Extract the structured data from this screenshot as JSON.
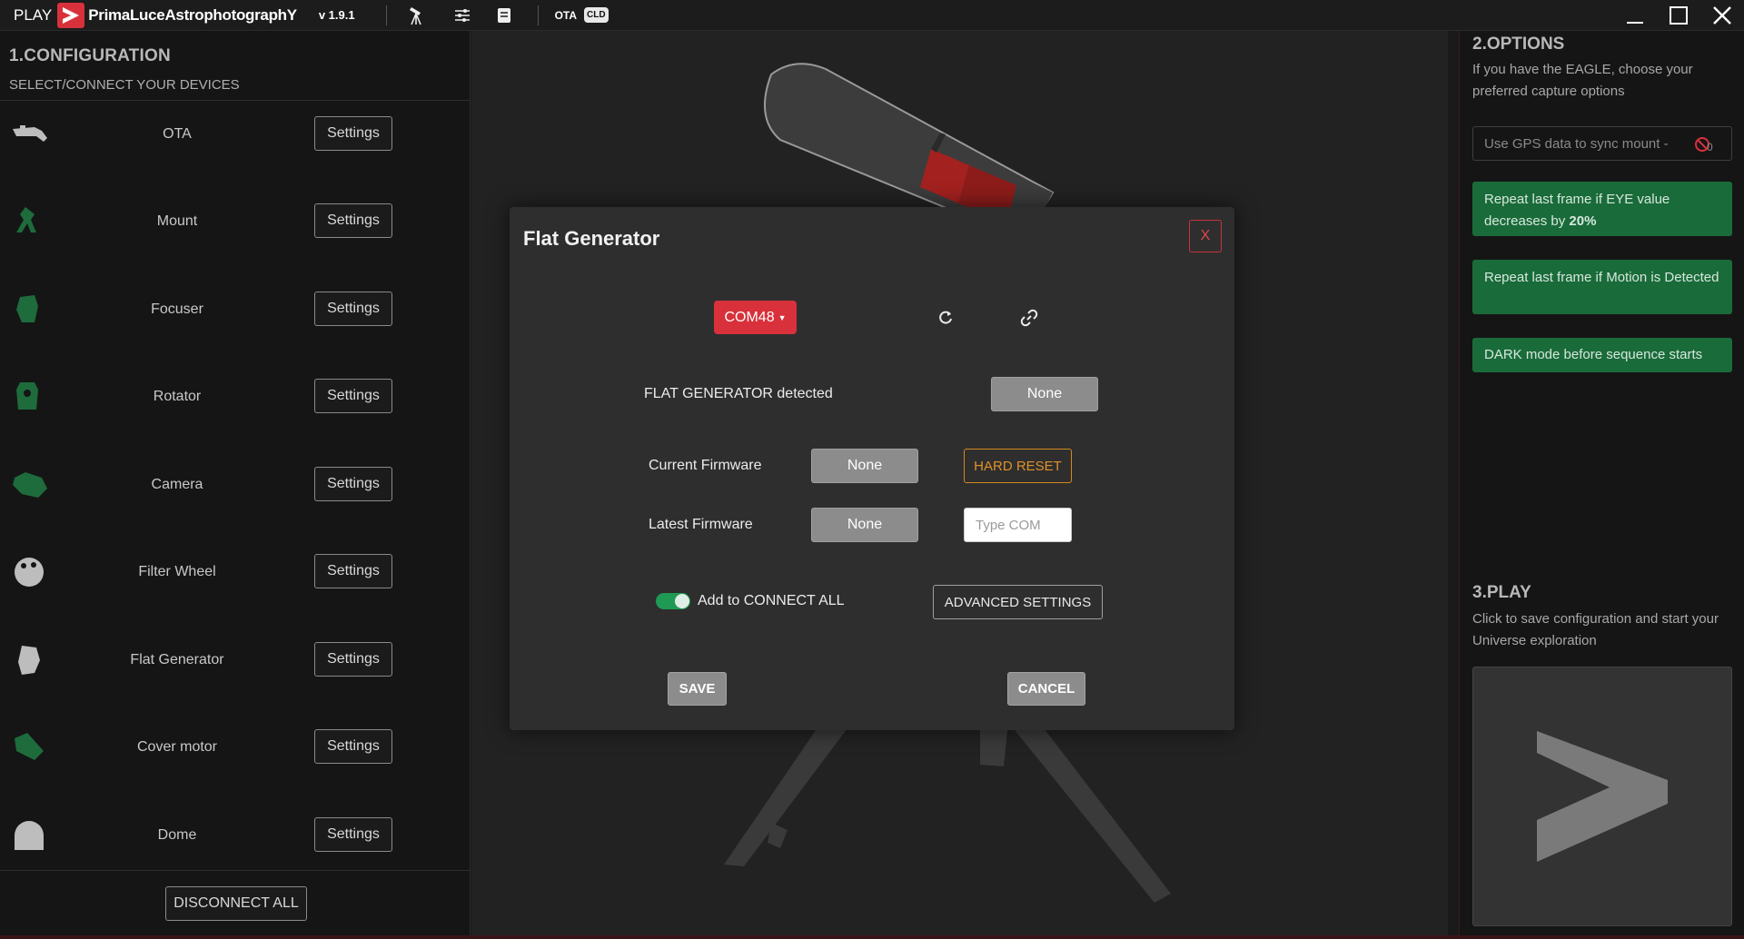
{
  "titlebar": {
    "play": "PLAY",
    "brand": "PrimaLuceAstrophotographY",
    "version": "v 1.9.1",
    "ota": "OTA",
    "cld": "CLD",
    "icons": [
      "telescope-icon",
      "sliders-icon",
      "list-icon"
    ]
  },
  "config": {
    "title": "1.CONFIGURATION",
    "subtitle": "SELECT/CONNECT YOUR DEVICES",
    "settings_label": "Settings",
    "devices": [
      {
        "label": "OTA",
        "icon": "ota-icon",
        "status": "idle"
      },
      {
        "label": "Mount",
        "icon": "mount-icon",
        "status": "connected"
      },
      {
        "label": "Focuser",
        "icon": "focuser-icon",
        "status": "connected"
      },
      {
        "label": "Rotator",
        "icon": "rotator-icon",
        "status": "connected"
      },
      {
        "label": "Camera",
        "icon": "camera-icon",
        "status": "connected"
      },
      {
        "label": "Filter Wheel",
        "icon": "filter-wheel-icon",
        "status": "idle"
      },
      {
        "label": "Flat Generator",
        "icon": "flat-generator-icon",
        "status": "idle"
      },
      {
        "label": "Cover motor",
        "icon": "cover-motor-icon",
        "status": "connected"
      },
      {
        "label": "Dome",
        "icon": "dome-icon",
        "status": "idle"
      }
    ],
    "disconnect_all": "DISCONNECT ALL"
  },
  "modal": {
    "title": "Flat Generator",
    "close": "X",
    "com_port": "COM48",
    "detected_label": "FLAT GENERATOR detected",
    "detected_value": "None",
    "current_fw_label": "Current Firmware",
    "current_fw_value": "None",
    "hard_reset": "HARD RESET",
    "latest_fw_label": "Latest Firmware",
    "latest_fw_value": "None",
    "type_com_placeholder": "Type COM",
    "connect_all_label": "Add to CONNECT ALL",
    "connect_all_enabled": true,
    "advanced_settings": "ADVANCED SETTINGS",
    "save": "SAVE",
    "cancel": "CANCEL"
  },
  "options": {
    "title": "2.OPTIONS",
    "description": "If you have the EAGLE, choose your preferred capture options",
    "gps_label": "Use GPS data to sync mount  -",
    "gps_count": "0",
    "repeat_eye_prefix": "Repeat last frame if EYE value decreases by",
    "repeat_eye_value": "20%",
    "repeat_motion": "Repeat last frame if Motion is Detected",
    "dark_mode": "DARK mode before sequence starts"
  },
  "play": {
    "title": "3.PLAY",
    "description": "Click to save configuration and start your Universe exploration"
  },
  "colors": {
    "accent_red": "#d8313b",
    "connected_green": "#1a6b3a",
    "device_idle": "#bdbdbd",
    "device_connected": "#1e6b3c",
    "warning_orange": "#e0912a"
  }
}
